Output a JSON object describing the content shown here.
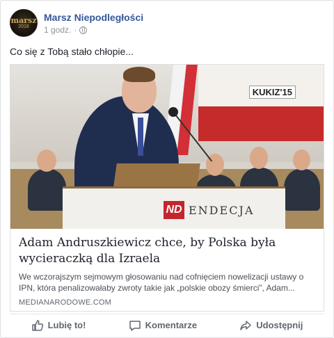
{
  "post": {
    "page_name": "Marsz Niepodległości",
    "avatar_logo": "marsz",
    "avatar_year": "2018",
    "time": "1 godz.",
    "separator": "·",
    "text": "Co się z Tobą stało chłopie..."
  },
  "link": {
    "image_texts": {
      "podium_logo": "ND",
      "podium_brand": "ENDECJA",
      "banner": "KUKIZ'15"
    },
    "title": "Adam Andruszkiewicz chce, by Polska była wycieraczką dla Izraela",
    "description": "We wczorajszym sejmowym głosowaniu nad cofnięciem nowelizacji ustawy o IPN, która penalizowałaby zwroty takie jak „polskie obozy śmierci”, Adam...",
    "domain": "MEDIANARODOWE.COM"
  },
  "actions": {
    "like": "Lubię to!",
    "comment": "Komentarze",
    "share": "Udostępnij"
  },
  "icons": [
    "globe-icon",
    "like-icon",
    "comment-icon",
    "share-icon"
  ],
  "colors": {
    "page_name": "#365899",
    "meta": "#90949c",
    "action": "#606770"
  }
}
